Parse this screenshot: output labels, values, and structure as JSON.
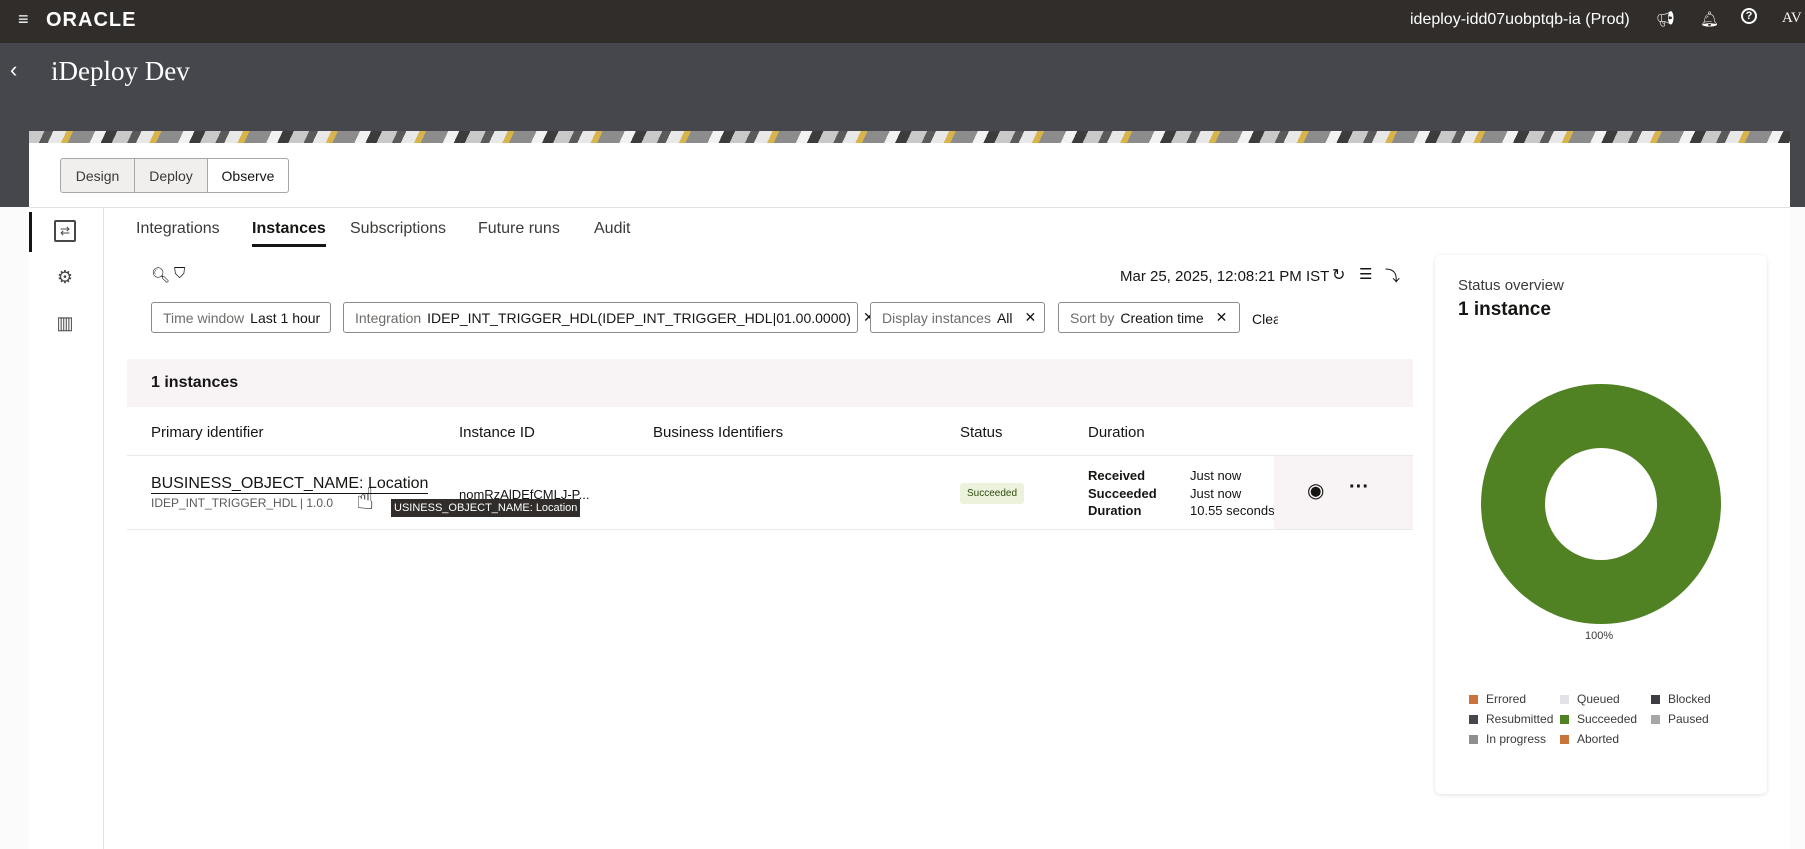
{
  "topbar": {
    "brand": "ORACLE",
    "environment": "ideploy-idd07uobptqb-ia (Prod)",
    "avatar": "AV"
  },
  "header": {
    "title": "iDeploy Dev"
  },
  "modes": [
    {
      "label": "Design"
    },
    {
      "label": "Deploy"
    },
    {
      "label": "Observe",
      "selected": true
    }
  ],
  "tabs": [
    {
      "label": "Integrations"
    },
    {
      "label": "Instances",
      "active": true
    },
    {
      "label": "Subscriptions"
    },
    {
      "label": "Future runs"
    },
    {
      "label": "Audit"
    }
  ],
  "toolbar": {
    "timestamp": "Mar 25, 2025, 12:08:21 PM IST"
  },
  "filters": [
    {
      "label": "Time window",
      "value": "Last 1 hour",
      "removable": false
    },
    {
      "label": "Integration",
      "value": "IDEP_INT_TRIGGER_HDL(IDEP_INT_TRIGGER_HDL|01.00.0000)",
      "removable": true
    },
    {
      "label": "Display instances",
      "value": "All",
      "removable": true
    },
    {
      "label": "Sort by",
      "value": "Creation time",
      "removable": true
    }
  ],
  "clear_label": "Clea",
  "results": {
    "count_label": "1 instances",
    "columns": [
      "Primary identifier",
      "Instance ID",
      "Business Identifiers",
      "Status",
      "Duration"
    ],
    "rows": [
      {
        "primary": "BUSINESS_OBJECT_NAME: Location",
        "sub": "IDEP_INT_TRIGGER_HDL | 1.0.0",
        "instance_id": "nomRzAlDEfCMLJ-P...",
        "business_identifiers": "",
        "status": "Succeeded",
        "received_label": "Received",
        "received": "Just now",
        "succeeded_label": "Succeeded",
        "succeeded": "Just now",
        "duration_label": "Duration",
        "duration": "10.55 seconds"
      }
    ]
  },
  "tooltip": "USINESS_OBJECT_NAME: Location",
  "overview": {
    "title": "Status overview",
    "count": "1 instance",
    "percent_label": "100%",
    "legend": [
      {
        "label": "Errored",
        "color": "#c8743a"
      },
      {
        "label": "Queued",
        "color": "#e4e2e6"
      },
      {
        "label": "Blocked",
        "color": "#3d3c40"
      },
      {
        "label": "Resubmitted",
        "color": "#45474c"
      },
      {
        "label": "Succeeded",
        "color": "#508223"
      },
      {
        "label": "Paused",
        "color": "#a8a6a6"
      },
      {
        "label": "In progress",
        "color": "#8f8e90"
      },
      {
        "label": "Aborted",
        "color": "#c8743a"
      }
    ],
    "chart_data": {
      "type": "pie",
      "categories": [
        "Succeeded"
      ],
      "values": [
        100
      ],
      "color": "#508223"
    }
  }
}
